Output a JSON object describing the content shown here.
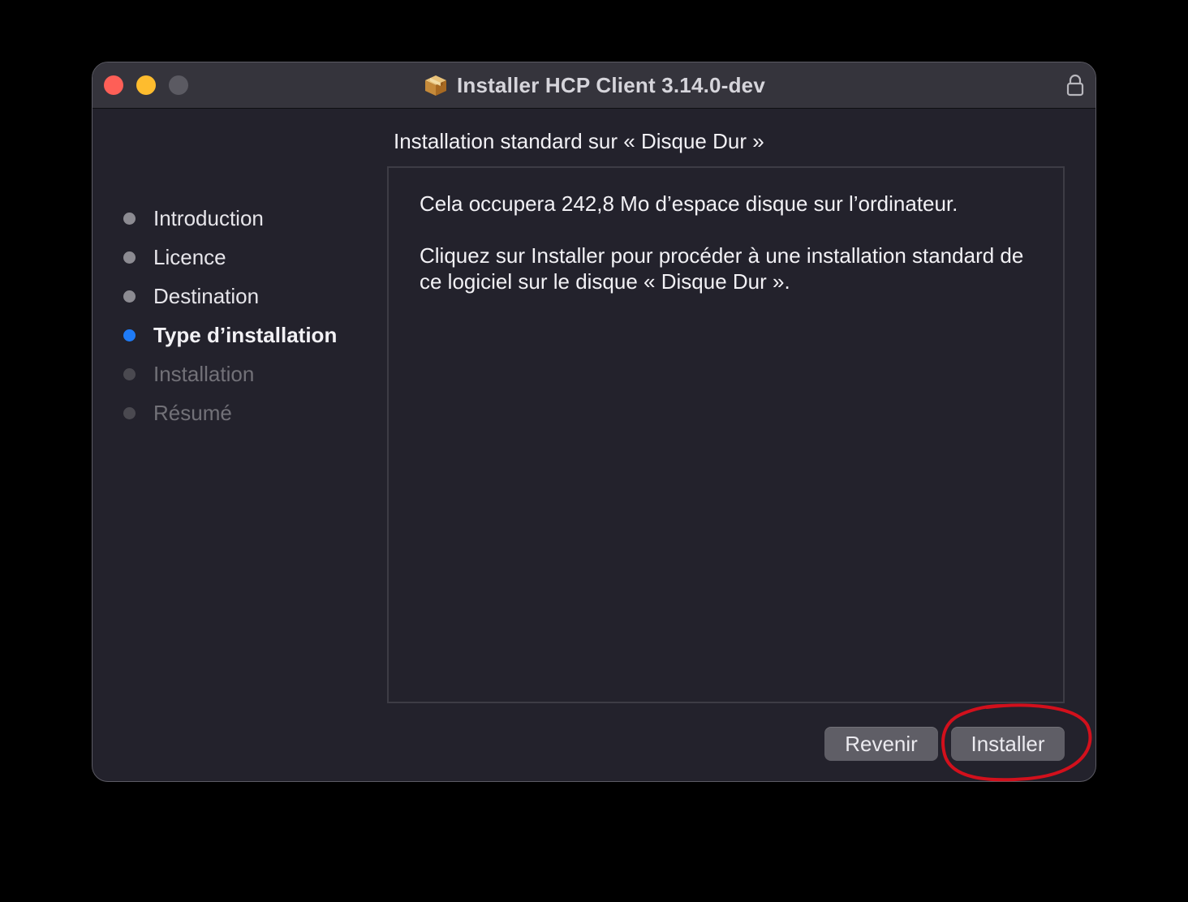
{
  "window": {
    "title": "Installer HCP Client 3.14.0-dev",
    "icons": {
      "app": "package-icon",
      "lock": "lock-icon"
    },
    "traffic_lights": [
      "close",
      "minimize",
      "zoom"
    ]
  },
  "sidebar": {
    "steps": [
      {
        "label": "Introduction",
        "state": "done"
      },
      {
        "label": "Licence",
        "state": "done"
      },
      {
        "label": "Destination",
        "state": "done"
      },
      {
        "label": "Type d’installation",
        "state": "active"
      },
      {
        "label": "Installation",
        "state": "pending"
      },
      {
        "label": "Résumé",
        "state": "pending"
      }
    ]
  },
  "main": {
    "heading": "Installation standard sur « Disque Dur »",
    "paragraph1": "Cela occupera 242,8 Mo d’espace disque sur l’ordinateur.",
    "paragraph2": "Cliquez sur Installer pour procéder à une installation standard de ce logiciel sur le disque « Disque Dur »."
  },
  "buttons": {
    "back_label": "Revenir",
    "install_label": "Installer"
  },
  "colors": {
    "accent": "#1f7bf6",
    "annotation": "#d2101c"
  }
}
